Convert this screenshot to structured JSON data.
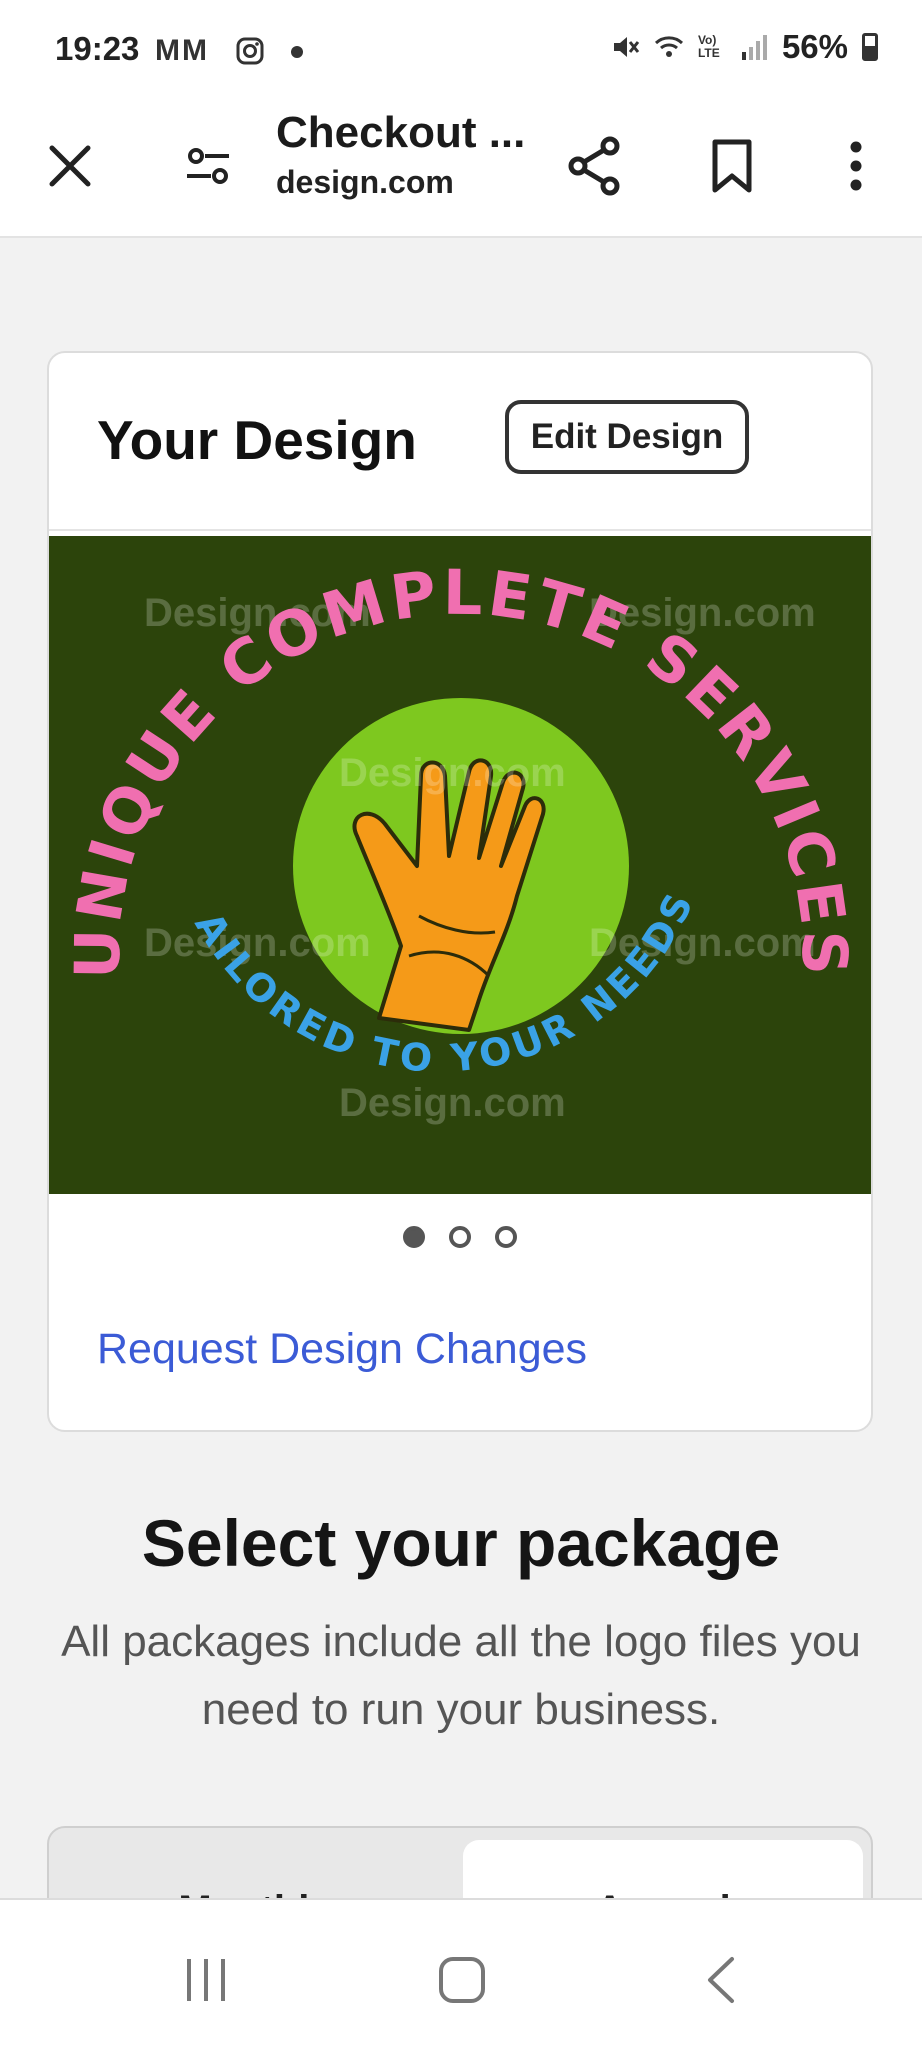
{
  "status_bar": {
    "time": "19:23",
    "notification_icons": "MM",
    "battery": "56%",
    "lte_label": "Vo) LTE"
  },
  "app_bar": {
    "title": "Checkout ...",
    "url": "design.com"
  },
  "design_card": {
    "title": "Your Design",
    "edit_button": "Edit Design",
    "request_link": "Request Design Changes",
    "carousel": {
      "total": 3,
      "active": 1
    },
    "logo": {
      "top_text": "UNIQUE COMPLETE SERVICES",
      "bottom_text": "TAILORED TO YOUR NEEDS",
      "watermark": "Design.com",
      "colors": {
        "background": "#2c440b",
        "circle": "#7ec81f",
        "hand": "#f59a18",
        "top_text": "#f06fb0",
        "bottom_text": "#3aa2e6"
      }
    }
  },
  "package": {
    "title": "Select your package",
    "subtitle": "All packages include all the logo files you need to run your business.",
    "toggle": {
      "monthly": "Monthly",
      "annual": "Annual",
      "selected": "Annual"
    }
  },
  "colors": {
    "link": "#3b5bd6",
    "page_bg": "#f2f2f2"
  }
}
